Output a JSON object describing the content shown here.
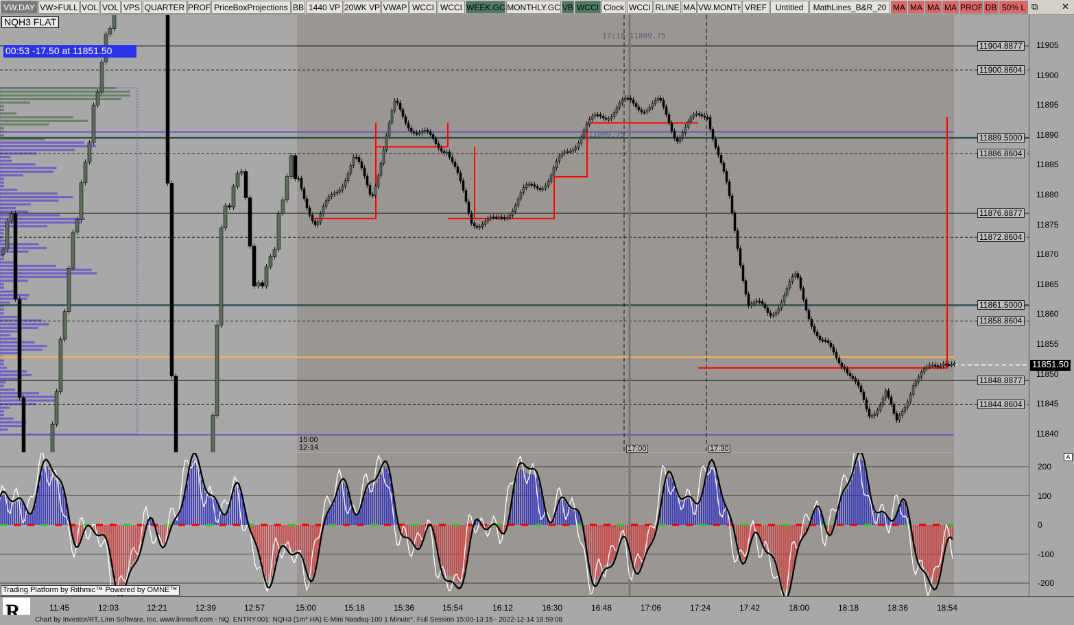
{
  "toolbar": {
    "buttons": [
      {
        "label": "VW.DAY",
        "bg": "#7a7a7a",
        "fg": "#fff"
      },
      {
        "label": "VW>FULL",
        "bg": "#e6e4df",
        "fg": "#000"
      },
      {
        "label": "VOL",
        "bg": "#e6e4df",
        "fg": "#000"
      },
      {
        "label": "VOL",
        "bg": "#e6e4df",
        "fg": "#000"
      },
      {
        "label": "VPS",
        "bg": "#e6e4df",
        "fg": "#000"
      },
      {
        "label": "QUARTER",
        "bg": "#e6e4df",
        "fg": "#000"
      },
      {
        "label": "PROF",
        "bg": "#e6e4df",
        "fg": "#000"
      },
      {
        "label": "PriceBoxProjections",
        "bg": "#e6e4df",
        "fg": "#000"
      },
      {
        "label": "BB",
        "bg": "#e6e4df",
        "fg": "#000"
      },
      {
        "label": "1440 VP",
        "bg": "#e6e4df",
        "fg": "#000"
      },
      {
        "label": "20WK VP",
        "bg": "#e6e4df",
        "fg": "#000"
      },
      {
        "label": "VWAP",
        "bg": "#e6e4df",
        "fg": "#000"
      },
      {
        "label": "WCCI",
        "bg": "#e6e4df",
        "fg": "#000"
      },
      {
        "label": "WCCI",
        "bg": "#e6e4df",
        "fg": "#000"
      },
      {
        "label": "WEEK.GC",
        "bg": "#4f7a63",
        "fg": "#000"
      },
      {
        "label": "MONTHLY.GC",
        "bg": "#e6e4df",
        "fg": "#000"
      },
      {
        "label": "VB",
        "bg": "#4f7a63",
        "fg": "#000"
      },
      {
        "label": "WCCI",
        "bg": "#4f7a63",
        "fg": "#000"
      },
      {
        "label": "Clock",
        "bg": "#e6e4df",
        "fg": "#000"
      },
      {
        "label": "WCCI",
        "bg": "#e6e4df",
        "fg": "#000"
      },
      {
        "label": "RLINE",
        "bg": "#e6e4df",
        "fg": "#000"
      },
      {
        "label": "MA",
        "bg": "#e6e4df",
        "fg": "#000"
      },
      {
        "label": "VW.MONTH",
        "bg": "#e6e4df",
        "fg": "#000"
      },
      {
        "label": "VREF",
        "bg": "#e6e4df",
        "fg": "#000"
      },
      {
        "label": "Untitled",
        "bg": "#e6e4df",
        "fg": "#000"
      },
      {
        "label": "MathLines_B&R_20",
        "bg": "#e6e4df",
        "fg": "#000"
      },
      {
        "label": "MA",
        "bg": "#e06666",
        "fg": "#000"
      },
      {
        "label": "MA",
        "bg": "#e06666",
        "fg": "#000"
      },
      {
        "label": "MA",
        "bg": "#e06666",
        "fg": "#000"
      },
      {
        "label": "MA",
        "bg": "#e06666",
        "fg": "#000"
      },
      {
        "label": "PROF",
        "bg": "#e06666",
        "fg": "#000"
      },
      {
        "label": "DB",
        "bg": "#e06666",
        "fg": "#000"
      },
      {
        "label": "50% L",
        "bg": "#e06666",
        "fg": "#000"
      }
    ],
    "restore_icon": "restore-window-icon",
    "close_icon": "close-window-icon"
  },
  "symbol": "NQH3 FLAT",
  "timer": "00:53  -17.50 at 11851.50",
  "annotation_top": "17:10  11809.75",
  "annotation_mid": "11809.75",
  "current_price": "11851.50",
  "price_ticks": [
    "11905",
    "11900",
    "11895",
    "11890",
    "11885",
    "11880",
    "11875",
    "11870",
    "11865",
    "11860",
    "11855",
    "11850",
    "11845",
    "11840"
  ],
  "levels": [
    {
      "label": "11904.8877",
      "price": 11904.8877,
      "style": "solid",
      "color": "#222"
    },
    {
      "label": "11900.8604",
      "price": 11900.8604,
      "style": "dashed",
      "color": "#222"
    },
    {
      "label": "11889.5000",
      "price": 11889.5,
      "style": "solid",
      "color": "#2f4f4f"
    },
    {
      "label": "11886.8604",
      "price": 11886.8604,
      "style": "dashed",
      "color": "#222"
    },
    {
      "label": "11876.8877",
      "price": 11876.8877,
      "style": "solid",
      "color": "#222"
    },
    {
      "label": "11872.8604",
      "price": 11872.8604,
      "style": "dashed",
      "color": "#222"
    },
    {
      "label": "11861.5000",
      "price": 11861.5,
      "style": "solid",
      "color": "#2f4f4f"
    },
    {
      "label": "11858.8604",
      "price": 11858.8604,
      "style": "dashed",
      "color": "#222"
    },
    {
      "label": "11848.8877",
      "price": 11848.8877,
      "style": "solid",
      "color": "#222"
    },
    {
      "label": "11844.8604",
      "price": 11844.8604,
      "style": "dashed",
      "color": "#222"
    }
  ],
  "session_labels": [
    {
      "time": "15:00",
      "date": "12-14"
    },
    {
      "time": "17:00",
      "date": ""
    },
    {
      "time": "17:30",
      "date": ""
    }
  ],
  "osc_ticks": [
    "200",
    "100",
    "0",
    "-100",
    "-200"
  ],
  "time_ticks": [
    "11:45",
    "12:03",
    "12:21",
    "12:39",
    "12:57",
    "15:00",
    "15:18",
    "15:36",
    "15:54",
    "16:12",
    "16:30",
    "16:48",
    "17:06",
    "17:24",
    "17:42",
    "18:00",
    "18:18",
    "18:36",
    "18:54"
  ],
  "rithmic": "Trading Platform by Rithmic™  Powered by OMNE™",
  "osc_badge": "A",
  "footer": "Chart by Investor/RT, Linn Software, Inc. www.linnsoft.com - NQ. ENTRY.001: NQH3 (1m* HA) E-Mini Nasdaq-100 1 Minute*, Full Session 15:00-13:15 - 2022-12-14 18:59:08",
  "colors": {
    "bull": "#5c6b5c",
    "bear": "#000000",
    "box": "#ff0000",
    "vwap_orange": "#f2b35a",
    "purple": "#6c4fbf",
    "osc_pos": "#2222cc",
    "osc_neg": "#dd3333"
  }
}
